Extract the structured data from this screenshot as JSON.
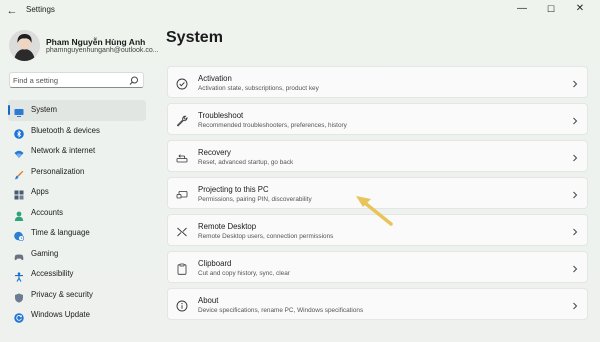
{
  "window": {
    "title": "Settings",
    "back_glyph": "←",
    "minimize_glyph": "—",
    "maximize_glyph": "☐",
    "close_glyph": "✕"
  },
  "profile": {
    "name": "Pham Nguyễn Hùng Anh",
    "email": "phamnguyenhunganh@outlook.co..."
  },
  "search": {
    "placeholder": "Find a setting"
  },
  "sidebar": {
    "accent_color": "#1468c6",
    "items": [
      {
        "label": "System",
        "icon": "monitor-icon",
        "active": true
      },
      {
        "label": "Bluetooth & devices",
        "icon": "bluetooth-icon"
      },
      {
        "label": "Network & internet",
        "icon": "wifi-icon"
      },
      {
        "label": "Personalization",
        "icon": "brush-icon"
      },
      {
        "label": "Apps",
        "icon": "apps-icon"
      },
      {
        "label": "Accounts",
        "icon": "person-icon"
      },
      {
        "label": "Time & language",
        "icon": "globe-clock-icon"
      },
      {
        "label": "Gaming",
        "icon": "gamepad-icon"
      },
      {
        "label": "Accessibility",
        "icon": "accessibility-icon"
      },
      {
        "label": "Privacy & security",
        "icon": "shield-icon"
      },
      {
        "label": "Windows Update",
        "icon": "update-icon"
      }
    ]
  },
  "main": {
    "title": "System",
    "cards": [
      {
        "title": "Activation",
        "subtitle": "Activation state, subscriptions, product key",
        "icon": "activation-check-icon"
      },
      {
        "title": "Troubleshoot",
        "subtitle": "Recommended troubleshooters, preferences, history",
        "icon": "wrench-icon"
      },
      {
        "title": "Recovery",
        "subtitle": "Reset, advanced startup, go back",
        "icon": "recovery-icon"
      },
      {
        "title": "Projecting to this PC",
        "subtitle": "Permissions, pairing PIN, discoverability",
        "icon": "projector-icon"
      },
      {
        "title": "Remote Desktop",
        "subtitle": "Remote Desktop users, connection permissions",
        "icon": "remote-desktop-icon"
      },
      {
        "title": "Clipboard",
        "subtitle": "Cut and copy history, sync, clear",
        "icon": "clipboard-icon"
      },
      {
        "title": "About",
        "subtitle": "Device specifications, rename PC, Windows specifications",
        "icon": "info-icon"
      }
    ]
  },
  "annotation": {
    "color": "#e8c45a",
    "icon": "pointer-arrow-icon"
  }
}
